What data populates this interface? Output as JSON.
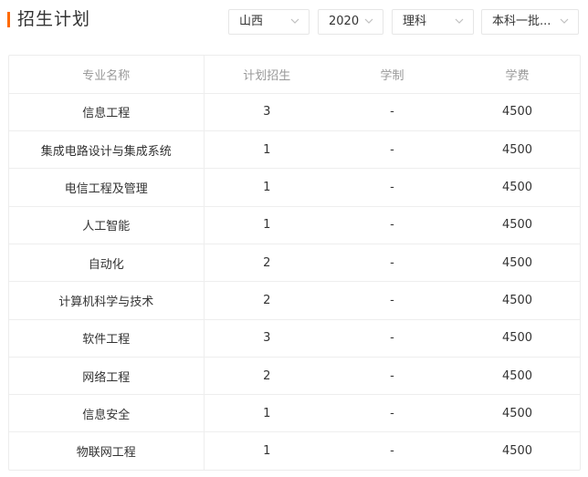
{
  "page": {
    "title": "招生计划",
    "accent_color": "#ff6a00"
  },
  "filters": {
    "province": "山西",
    "year": "2020",
    "subject": "理科",
    "batch": "本科一批...",
    "chevron_icon": "chevron-down-icon"
  },
  "table": {
    "headers": [
      "专业名称",
      "计划招生",
      "学制",
      "学费"
    ],
    "rows": [
      [
        "信息工程",
        "3",
        "-",
        "4500"
      ],
      [
        "集成电路设计与集成系统",
        "1",
        "-",
        "4500"
      ],
      [
        "电信工程及管理",
        "1",
        "-",
        "4500"
      ],
      [
        "人工智能",
        "1",
        "-",
        "4500"
      ],
      [
        "自动化",
        "2",
        "-",
        "4500"
      ],
      [
        "计算机科学与技术",
        "2",
        "-",
        "4500"
      ],
      [
        "软件工程",
        "3",
        "-",
        "4500"
      ],
      [
        "网络工程",
        "2",
        "-",
        "4500"
      ],
      [
        "信息安全",
        "1",
        "-",
        "4500"
      ],
      [
        "物联网工程",
        "1",
        "-",
        "4500"
      ]
    ]
  }
}
